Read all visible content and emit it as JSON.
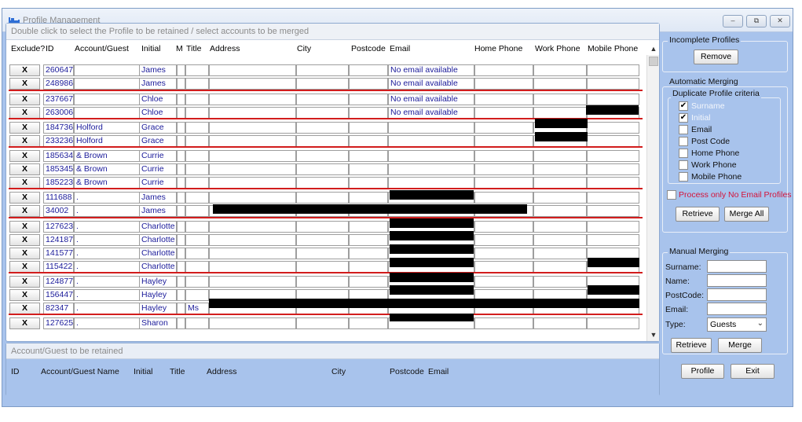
{
  "window": {
    "title": "Profile Management",
    "minimize": "–",
    "maximize": "⧉",
    "close": "✕"
  },
  "grid": {
    "caption": "Double click to select the Profile to be retained / select accounts to be merged",
    "columns": [
      "Exclude?",
      "ID",
      "Account/Guest",
      "Initial",
      "M",
      "Title",
      "Address",
      "City",
      "Postcode",
      "Email",
      "Home Phone",
      "Work Phone",
      "Mobile Phone"
    ],
    "exclude_label": "X",
    "rows": [
      {
        "id": "260647",
        "account": "",
        "initial": "James",
        "title": "",
        "email": "No email available"
      },
      {
        "id": "248986",
        "account": "",
        "initial": "James",
        "title": "",
        "email": "No email available"
      },
      {
        "id": "237667",
        "account": "",
        "initial": "Chloe",
        "title": "",
        "email": "No email available"
      },
      {
        "id": "263006",
        "account": "",
        "initial": "Chloe",
        "title": "",
        "email": "No email available"
      },
      {
        "id": "184736",
        "account": "Holford",
        "initial": "Grace",
        "title": "",
        "email": ""
      },
      {
        "id": "233236",
        "account": "Holford",
        "initial": "Grace",
        "title": "",
        "email": ""
      },
      {
        "id": "185634",
        "account": "& Brown",
        "initial": "Currie",
        "title": "",
        "email": ""
      },
      {
        "id": "185345",
        "account": "& Brown",
        "initial": "Currie",
        "title": "",
        "email": ""
      },
      {
        "id": "185223",
        "account": "& Brown",
        "initial": "Currie",
        "title": "",
        "email": ""
      },
      {
        "id": "111688",
        "account": ".",
        "initial": "James",
        "title": "",
        "email": ""
      },
      {
        "id": "34002",
        "account": ".",
        "initial": "James",
        "title": "",
        "email": ""
      },
      {
        "id": "127623",
        "account": ".",
        "initial": "Charlotte",
        "title": "",
        "email": ""
      },
      {
        "id": "124187",
        "account": ".",
        "initial": "Charlotte",
        "title": "",
        "email": ""
      },
      {
        "id": "141577",
        "account": ".",
        "initial": "Charlotte",
        "title": "",
        "email": ""
      },
      {
        "id": "115422",
        "account": ".",
        "initial": "Charlotte",
        "title": "",
        "email": ""
      },
      {
        "id": "124877",
        "account": ".",
        "initial": "Hayley",
        "title": "",
        "email": ""
      },
      {
        "id": "156447",
        "account": ".",
        "initial": "Hayley",
        "title": "",
        "email": ""
      },
      {
        "id": "82347",
        "account": ".",
        "initial": "Hayley",
        "title": "Ms",
        "email": ""
      },
      {
        "id": "127625",
        "account": ".",
        "initial": "Sharon",
        "title": "",
        "email": ""
      }
    ]
  },
  "retained": {
    "caption": "Account/Guest to be retained",
    "columns": [
      "ID",
      "Account/Guest Name",
      "Initial",
      "Title",
      "Address",
      "City",
      "Postcode",
      "Email"
    ]
  },
  "incomplete": {
    "title": "Incomplete Profiles",
    "remove_button": "Remove"
  },
  "automatic": {
    "title": "Automatic Merging",
    "criteria_title": "Duplicate Profile criteria",
    "criteria": [
      {
        "label": "Surname",
        "checked": true,
        "disabled": true
      },
      {
        "label": "Initial",
        "checked": true,
        "disabled": true
      },
      {
        "label": "Email",
        "checked": false,
        "disabled": false
      },
      {
        "label": "Post Code",
        "checked": false,
        "disabled": false
      },
      {
        "label": "Home Phone",
        "checked": false,
        "disabled": false
      },
      {
        "label": "Work Phone",
        "checked": false,
        "disabled": false
      },
      {
        "label": "Mobile Phone",
        "checked": false,
        "disabled": false
      }
    ],
    "no_email_label": "Process only No Email Profiles",
    "no_email_color": "#d4133a",
    "retrieve_button": "Retrieve",
    "merge_all_button": "Merge All"
  },
  "manual": {
    "title": "Manual Merging",
    "surname_label": "Surname:",
    "name_label": "Name:",
    "postcode_label": "PostCode:",
    "email_label": "Email:",
    "type_label": "Type:",
    "type_value": "Guests",
    "retrieve_button": "Retrieve",
    "merge_button": "Merge"
  },
  "footer": {
    "profile_button": "Profile",
    "exit_button": "Exit"
  },
  "colors": {
    "panel": "#a8c3ec",
    "separator": "#d21d1d",
    "link_text": "#1b1b9a"
  }
}
